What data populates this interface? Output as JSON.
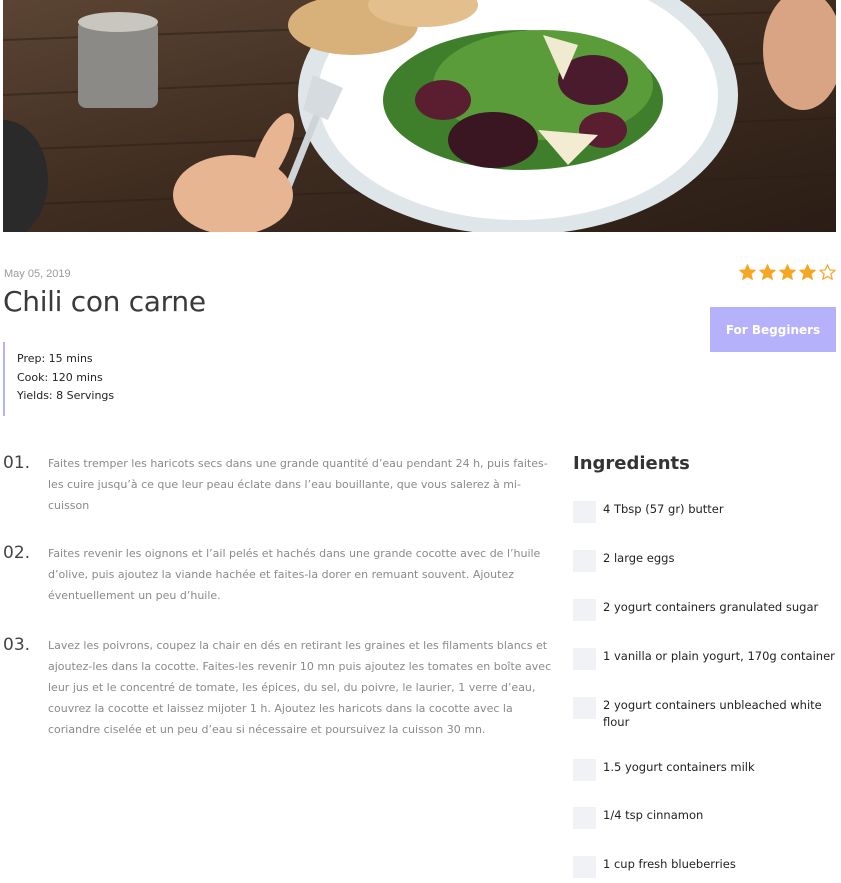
{
  "recipe": {
    "date": "May 05, 2019",
    "title": "Chili con carne",
    "rating": {
      "value": 4,
      "max": 5
    },
    "level_label": "For Begginers",
    "meta": {
      "prep": "Prep: 15 mins",
      "cook": "Cook: 120 mins",
      "yields": "Yields: 8 Servings"
    }
  },
  "steps": [
    {
      "num": "01.",
      "text": "Faites tremper les haricots secs dans une grande quantité d’eau pendant 24 h, puis faites-les cuire jusqu’à ce que leur peau éclate dans l’eau bouillante, que vous salerez à mi-cuisson"
    },
    {
      "num": "02.",
      "text": "Faites revenir les oignons et l’ail pelés et hachés dans une grande cocotte avec de l’huile d’olive, puis ajoutez la viande hachée et faites-la dorer en remuant souvent. Ajoutez éventuellement un peu d’huile."
    },
    {
      "num": "03.",
      "text": "Lavez les poivrons, coupez la chair en dés en retirant les graines et les filaments blancs et ajoutez-les dans la cocotte. Faites-les revenir 10 mn puis ajoutez les tomates en boîte avec leur jus et le concentré de tomate, les épices, du sel, du poivre, le laurier, 1 verre d’eau, couvrez la cocotte et laissez mijoter 1 h. Ajoutez les haricots dans la cocotte avec la coriandre ciselée et un peu d’eau si nécessaire et poursuivez la cuisson 30 mn."
    }
  ],
  "ingredients": {
    "title": "Ingredients",
    "items": [
      "4 Tbsp (57 gr) butter",
      "2 large eggs",
      "2 yogurt containers granulated sugar",
      "1 vanilla or plain yogurt, 170g container",
      "2 yogurt containers unbleached white flour",
      "1.5 yogurt containers milk",
      "1/4 tsp cinnamon",
      "1 cup fresh blueberries"
    ]
  },
  "colors": {
    "accent": "#b6b1fb",
    "star": "#f5a623",
    "checkbox": "#f1f2f6"
  }
}
